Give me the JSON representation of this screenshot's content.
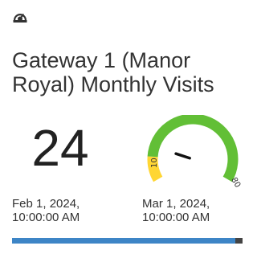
{
  "widget": {
    "icon": "speedometer-icon",
    "title": "Gateway 1 (Manor Royal) Monthly Visits",
    "value": "24",
    "gauge": {
      "min_label": "10",
      "max_label": "80",
      "min": 10,
      "max": 80,
      "value": 24,
      "colors": {
        "low": "#ffd633",
        "high": "#62bf36",
        "needle": "#111111"
      }
    },
    "start_date": "Feb 1, 2024,\n10:00:00 AM",
    "end_date": "Mar 1, 2024,\n10:00:00 AM",
    "progress": 0.97,
    "colors": {
      "progress_fill": "#3d85c6",
      "progress_track": "#444444"
    }
  }
}
